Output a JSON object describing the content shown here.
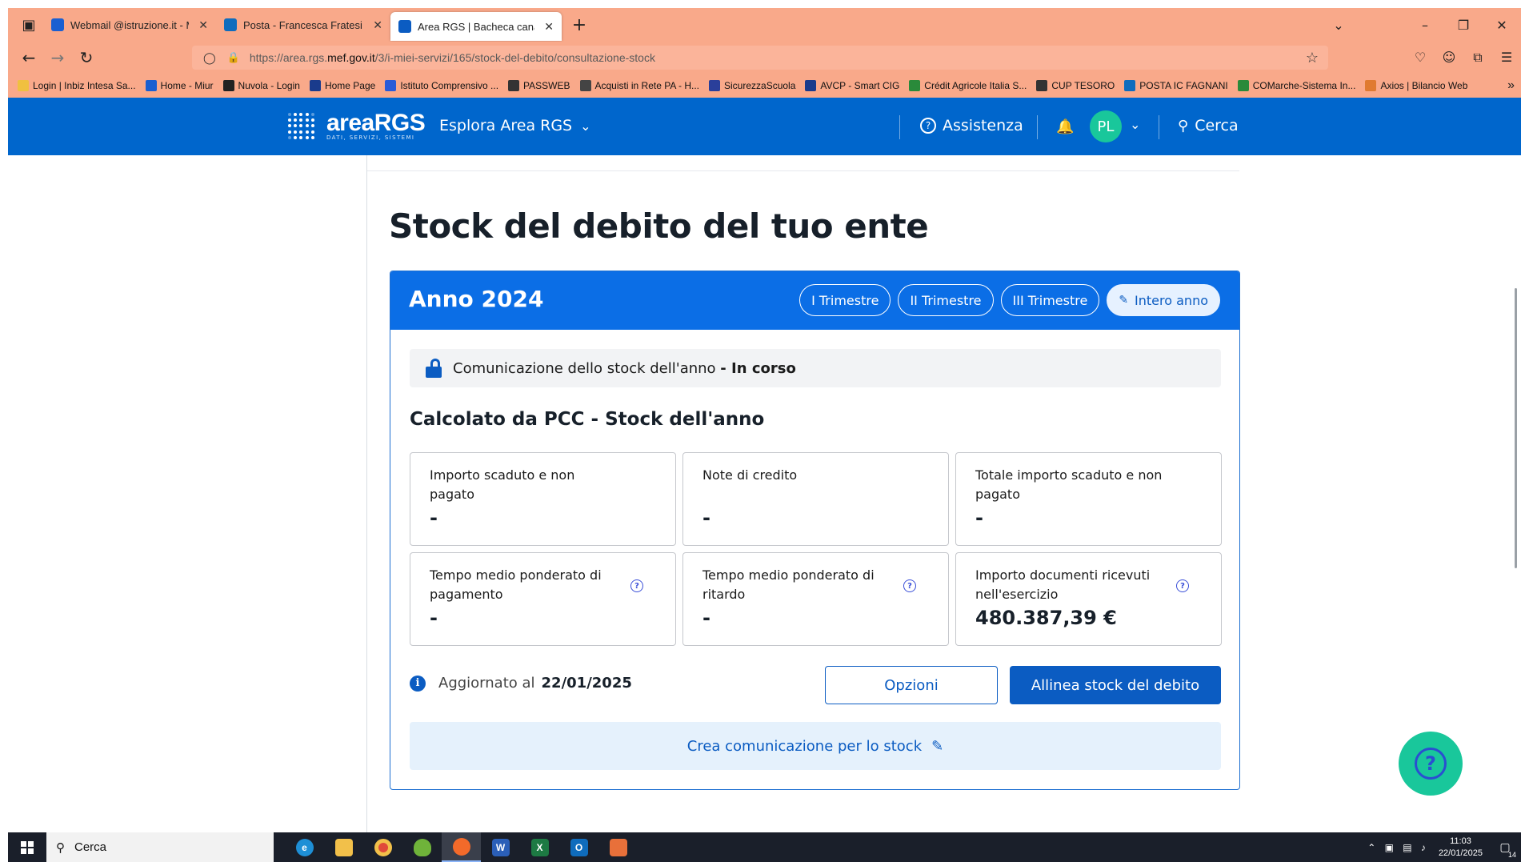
{
  "browser": {
    "tabs": [
      {
        "title": "Webmail @istruzione.it - Miur",
        "icon": "miur-mail-icon",
        "color": "#1a5fd1"
      },
      {
        "title": "Posta - Francesca Fratesi - Outl",
        "icon": "outlook-icon",
        "color": "#0f6cbd"
      },
      {
        "title": "Area RGS | Bacheca canali",
        "icon": "rgs-grid-icon",
        "color": "#0b5cc2"
      }
    ],
    "url_prefix": "https://area.rgs.",
    "url_domain": "mef.gov.it",
    "url_path": "/3/i-miei-servizi/165/stock-del-debito/consultazione-stock",
    "bookmarks": [
      "Login | Inbiz Intesa Sa...",
      "Home - Miur",
      "Nuvola - Login",
      "Home Page",
      "Istituto Comprensivo ...",
      "PASSWEB",
      "Acquisti in Rete PA - H...",
      "SicurezzaScuola",
      "AVCP - Smart CIG",
      "Crédit Agricole Italia S...",
      "CUP TESORO",
      "POSTA IC FAGNANI",
      "COMarche-Sistema In...",
      "Axios | Bilancio Web"
    ],
    "chrome_color": "#f9a98a"
  },
  "header": {
    "brand": "areaRGS",
    "tagline": "DATI, SERVIZI, SISTEMI",
    "explore": "Esplora Area RGS",
    "assist": "Assistenza",
    "avatar": "PL",
    "search": "Cerca",
    "color": "#0066cc"
  },
  "page": {
    "title": "Stock del debito del tuo ente"
  },
  "card": {
    "year": "Anno 2024",
    "periods": [
      "I Trimestre",
      "II Trimestre",
      "III Trimestre",
      "Intero anno"
    ],
    "active_period": "Intero anno",
    "status_text": "Comunicazione dello stock dell'anno",
    "status_value": "- In corso",
    "calc_title": "Calcolato da PCC - Stock dell'anno",
    "tiles": [
      {
        "label": "Importo scaduto e non pagato",
        "value": "-"
      },
      {
        "label": "Note di credito",
        "value": "-"
      },
      {
        "label": "Totale importo scaduto e non pagato",
        "value": "-"
      },
      {
        "label": "Tempo medio ponderato di pagamento",
        "value": "-"
      },
      {
        "label": "Tempo medio ponderato di ritardo",
        "value": "-"
      },
      {
        "label": "Importo documenti ricevuti nell'esercizio",
        "value": "480.387,39 €"
      }
    ],
    "updated_label": "Aggiornato al",
    "updated_date": "22/01/2025",
    "options_btn": "Opzioni",
    "align_btn": "Allinea stock del debito",
    "create_link": "Crea comunicazione per lo stock",
    "accent": "#0b5cc2"
  },
  "taskbar": {
    "search": "Cerca",
    "time": "11:03",
    "date": "22/01/2025",
    "notifications": "14"
  }
}
